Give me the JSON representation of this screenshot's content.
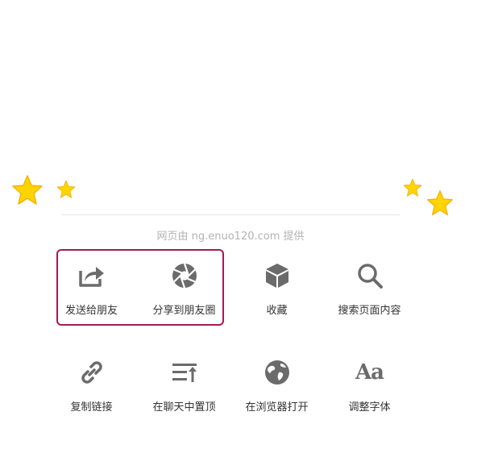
{
  "provider_text": "网页由 ng.enuo120.com 提供",
  "colors": {
    "icon": "#6b6b6b",
    "highlight": "#a41a55",
    "star": "#ffd400"
  },
  "row1": [
    {
      "label": "发送给朋友",
      "icon": "share-icon"
    },
    {
      "label": "分享到朋友圈",
      "icon": "moments-shutter-icon"
    },
    {
      "label": "收藏",
      "icon": "favorite-cube-icon"
    },
    {
      "label": "搜索页面内容",
      "icon": "search-icon"
    }
  ],
  "row2": [
    {
      "label": "复制链接",
      "icon": "link-icon"
    },
    {
      "label": "在聊天中置顶",
      "icon": "pin-top-icon"
    },
    {
      "label": "在浏览器打开",
      "icon": "globe-icon"
    },
    {
      "label": "调整字体",
      "icon": "font-size-icon",
      "glyph": "Aa"
    }
  ]
}
